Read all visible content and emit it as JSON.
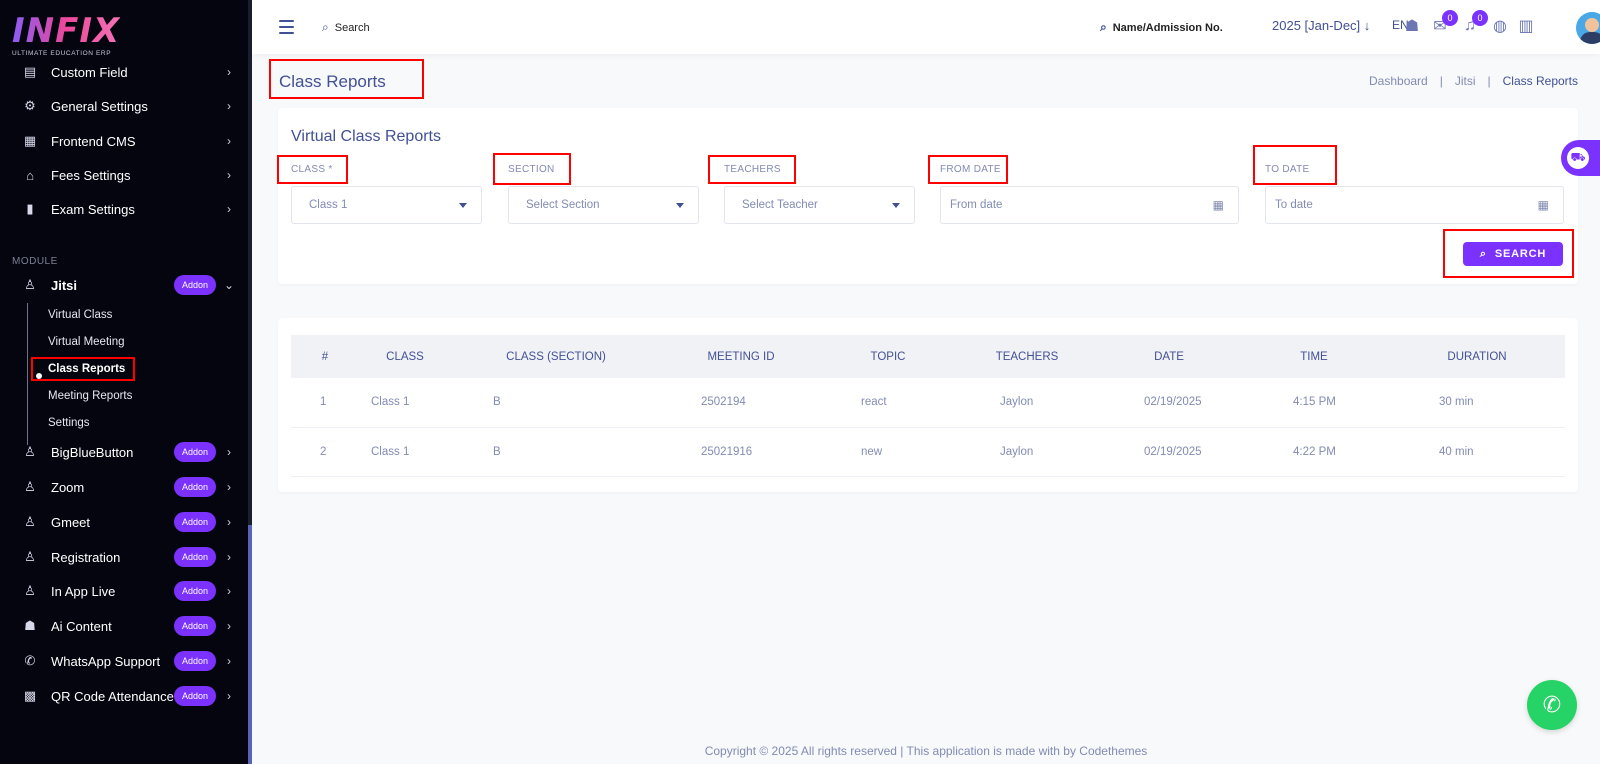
{
  "brand": {
    "name": "INFIX",
    "tagline": "ULTIMATE EDUCATION ERP"
  },
  "sidebar": {
    "items_top": [
      {
        "label": "Custom Field",
        "icon": "custom-field-icon",
        "glyph": "▤"
      },
      {
        "label": "General Settings",
        "icon": "gears-icon",
        "glyph": "⚙"
      },
      {
        "label": "Frontend CMS",
        "icon": "cms-icon",
        "glyph": "▦"
      },
      {
        "label": "Fees Settings",
        "icon": "bank-icon",
        "glyph": "⌂"
      },
      {
        "label": "Exam Settings",
        "icon": "book-icon",
        "glyph": "▮"
      }
    ],
    "module_label": "MODULE",
    "jitsi": {
      "label": "Jitsi",
      "badge": "Addon"
    },
    "jitsi_sub": [
      "Virtual Class",
      "Virtual Meeting",
      "Class Reports",
      "Meeting Reports",
      "Settings"
    ],
    "addons": [
      {
        "label": "BigBlueButton",
        "badge": "Addon",
        "icon": "module-icon",
        "glyph": "♙"
      },
      {
        "label": "Zoom",
        "badge": "Addon",
        "icon": "module-icon",
        "glyph": "♙"
      },
      {
        "label": "Gmeet",
        "badge": "Addon",
        "icon": "module-icon",
        "glyph": "♙"
      },
      {
        "label": "Registration",
        "badge": "Addon",
        "icon": "module-icon",
        "glyph": "♙"
      },
      {
        "label": "In App Live",
        "badge": "Addon",
        "icon": "module-icon",
        "glyph": "♙"
      },
      {
        "label": "Ai Content",
        "badge": "Addon",
        "icon": "robot-icon",
        "glyph": "☗"
      },
      {
        "label": "WhatsApp Support",
        "badge": "Addon",
        "icon": "whatsapp-icon",
        "glyph": "✆"
      },
      {
        "label": "QR Code Attendance",
        "badge": "Addon",
        "icon": "qr-code-icon",
        "glyph": "▩"
      }
    ]
  },
  "header": {
    "search_label": "Search",
    "admission_search": "Name/Admission No.",
    "session": "2025 [Jan-Dec]",
    "language": "EN",
    "messages_count": "0",
    "notifications_count": "0"
  },
  "page": {
    "title": "Class Reports",
    "breadcrumb": [
      "Dashboard",
      "Jitsi",
      "Class Reports"
    ]
  },
  "filters": {
    "card_title": "Virtual Class Reports",
    "class_label": "CLASS *",
    "class_value": "Class 1",
    "section_label": "SECTION",
    "section_placeholder": "Select Section",
    "teachers_label": "TEACHERS",
    "teachers_placeholder": "Select Teacher",
    "from_label": "FROM DATE",
    "from_placeholder": "From date",
    "to_label": "TO DATE",
    "to_placeholder": "To date",
    "search_button": "SEARCH"
  },
  "table": {
    "columns": [
      "#",
      "CLASS",
      "CLASS (SECTION)",
      "MEETING ID",
      "TOPIC",
      "TEACHERS",
      "DATE",
      "TIME",
      "DURATION"
    ],
    "rows": [
      [
        "1",
        "Class 1",
        "B",
        "2502194",
        "react",
        "Jaylon",
        "02/19/2025",
        "4:15 PM",
        "30 min"
      ],
      [
        "2",
        "Class 1",
        "B",
        "25021916",
        "new",
        "Jaylon",
        "02/19/2025",
        "4:22 PM",
        "40 min"
      ]
    ]
  },
  "footer": "Copyright © 2025 All rights reserved | This application is made with by Codethemes",
  "colors": {
    "accent": "#7c32ff",
    "highlight": "#ff0000",
    "text": "#415094",
    "sidebar_bg": "#04050f",
    "whatsapp": "#25d366"
  }
}
